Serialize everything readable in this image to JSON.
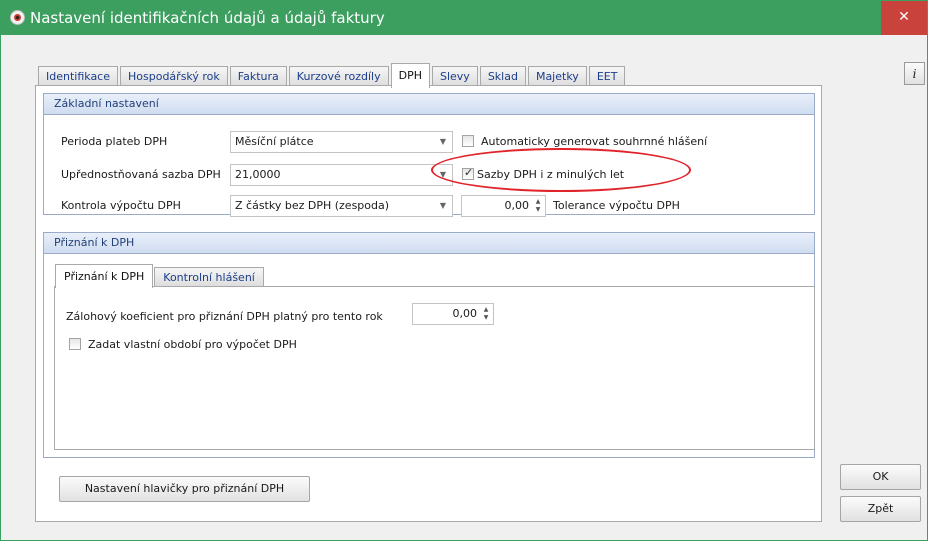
{
  "window": {
    "title": "Nastavení identifikačních údajů a údajů faktury",
    "close_glyph": "✕"
  },
  "tabs": [
    {
      "label": "Identifikace"
    },
    {
      "label": "Hospodářský rok"
    },
    {
      "label": "Faktura"
    },
    {
      "label": "Kurzové rozdíly"
    },
    {
      "label": "DPH",
      "active": true
    },
    {
      "label": "Slevy"
    },
    {
      "label": "Sklad"
    },
    {
      "label": "Majetky"
    },
    {
      "label": "EET"
    }
  ],
  "info_button": {
    "label": "i"
  },
  "zakladni": {
    "header": "Základní nastavení",
    "perioda_label": "Perioda plateb DPH",
    "perioda_value": "Měsíční plátce",
    "sazba_label": "Upřednostňovaná sazba DPH",
    "sazba_value": "21,0000",
    "kontrola_label": "Kontrola výpočtu DPH",
    "kontrola_value": "Z částky bez DPH (zespoda)",
    "auto_label": "Automaticky generovat souhrnné hlášení",
    "auto_checked": false,
    "sazby_label": "Sazby DPH i z minulých let",
    "sazby_checked": true,
    "tolerance_value": "0,00",
    "tolerance_label": "Tolerance výpočtu DPH"
  },
  "priznani": {
    "header": "Přiznání k DPH",
    "subtabs": [
      {
        "label": "Přiznání k DPH",
        "active": true
      },
      {
        "label": "Kontrolní hlášení"
      }
    ],
    "koef_label": "Zálohový koeficient pro přiznání DPH platný pro tento rok",
    "koef_value": "0,00",
    "obdobi_label": "Zadat vlastní období pro výpočet DPH",
    "obdobi_checked": false
  },
  "buttons": {
    "hlavicka": "Nastavení hlavičky pro přiznání DPH",
    "ok": "OK",
    "zpet": "Zpět"
  },
  "colors": {
    "titlebar": "#3c9e5f",
    "close": "#c9423b",
    "group_header": "#cfdcf0",
    "highlight_ellipse": "#e0242a"
  },
  "icons": {
    "app": "app-logo-icon",
    "close": "close-icon",
    "dropdown": "chevron-down-icon",
    "spin": "spin-updown-icon",
    "info": "info-icon"
  }
}
